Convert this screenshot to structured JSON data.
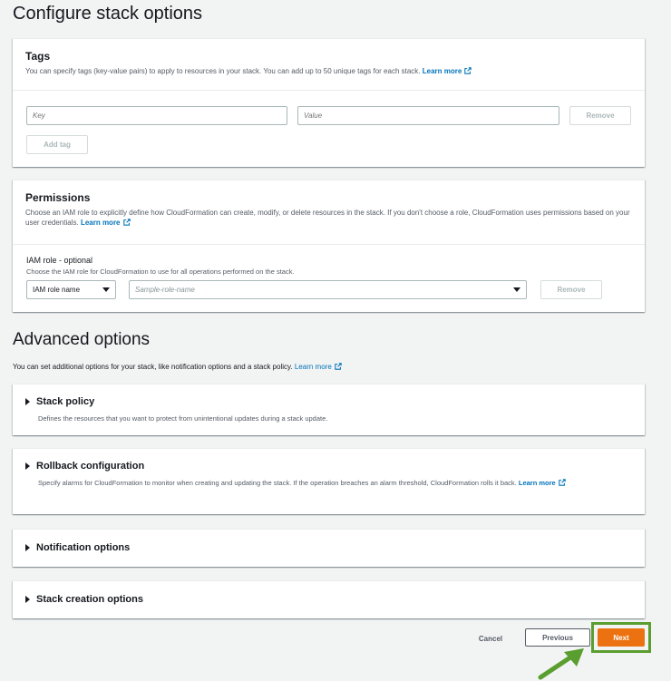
{
  "page": {
    "title": "Configure stack options"
  },
  "tags": {
    "title": "Tags",
    "description": "You can specify tags (key-value pairs) to apply to resources in your stack. You can add up to 50 unique tags for each stack.",
    "learn_more": "Learn more",
    "key_placeholder": "Key",
    "value_placeholder": "Value",
    "remove_label": "Remove",
    "add_tag_label": "Add tag"
  },
  "permissions": {
    "title": "Permissions",
    "description": "Choose an IAM role to explicitly define how CloudFormation can create, modify, or delete resources in the stack. If you don't choose a role, CloudFormation uses permissions based on your user credentials.",
    "learn_more": "Learn more",
    "iam_label": "IAM role - optional",
    "iam_hint": "Choose the IAM role for CloudFormation to use for all operations performed on the stack.",
    "role_type_selected": "IAM role name",
    "role_placeholder": "Sample-role-name",
    "remove_label": "Remove"
  },
  "advanced": {
    "title": "Advanced options",
    "description": "You can set additional options for your stack, like notification options and a stack policy.",
    "learn_more": "Learn more",
    "sections": [
      {
        "title": "Stack policy",
        "description": "Defines the resources that you want to protect from unintentional updates during a stack update."
      },
      {
        "title": "Rollback configuration",
        "description": "Specify alarms for CloudFormation to monitor when creating and updating the stack. If the operation breaches an alarm threshold, CloudFormation rolls it back.",
        "learn_more": "Learn more"
      },
      {
        "title": "Notification options"
      },
      {
        "title": "Stack creation options"
      }
    ]
  },
  "footer": {
    "cancel_label": "Cancel",
    "previous_label": "Previous",
    "next_label": "Next"
  },
  "colors": {
    "accent_orange": "#ec7211",
    "link_blue": "#0073bb",
    "highlight_green": "#5a9e2f",
    "background": "#f2f3f3"
  },
  "icons": {
    "external_link": "external-link-icon",
    "expand": "caret-right-icon",
    "dropdown": "caret-down-icon",
    "annotation": "arrow-icon"
  }
}
